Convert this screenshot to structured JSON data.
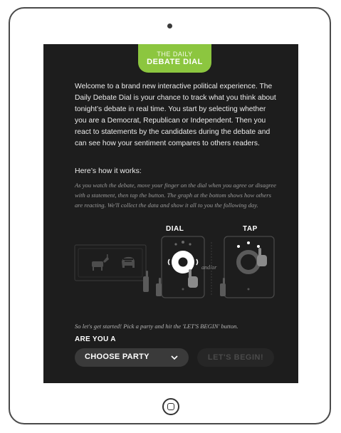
{
  "header": {
    "tab_small": "THE DAILY",
    "tab_big": "DEBATE DIAL"
  },
  "intro": {
    "text": "Welcome to a brand new interactive political experience. The Daily Debate Dial is your chance to track what you think about tonight’s debate in real time. You start by selecting whether you are a Democrat, Republican or Independent. Then you react to statements by the candidates during the debate and can see how your sentiment compares to others readers."
  },
  "how": {
    "heading": "Here’s how it works:",
    "text": "As you watch the debate, move your finger on the dial when you agree or disagree with a statement, then tap the button. The graph at the bottom shows how others are reacting. We'll collect the data and show it all to you the following day."
  },
  "illustration": {
    "dial_label": "DIAL",
    "tap_label": "TAP",
    "andor": "and/or"
  },
  "start": {
    "text": "So let's get started! Pick a party and hit the 'LET'S BEGIN' button.",
    "question": "ARE YOU A",
    "choose_label": "CHOOSE PARTY",
    "begin_label": "LET'S BEGIN!"
  },
  "colors": {
    "accent": "#8cc63f",
    "screen_bg": "#1d1d1d",
    "button_bg": "#3a3a3a"
  },
  "icons": [
    "camera-icon",
    "home-button-icon",
    "chevron-down-icon",
    "donkey-icon",
    "elephant-icon",
    "hand-icon"
  ]
}
